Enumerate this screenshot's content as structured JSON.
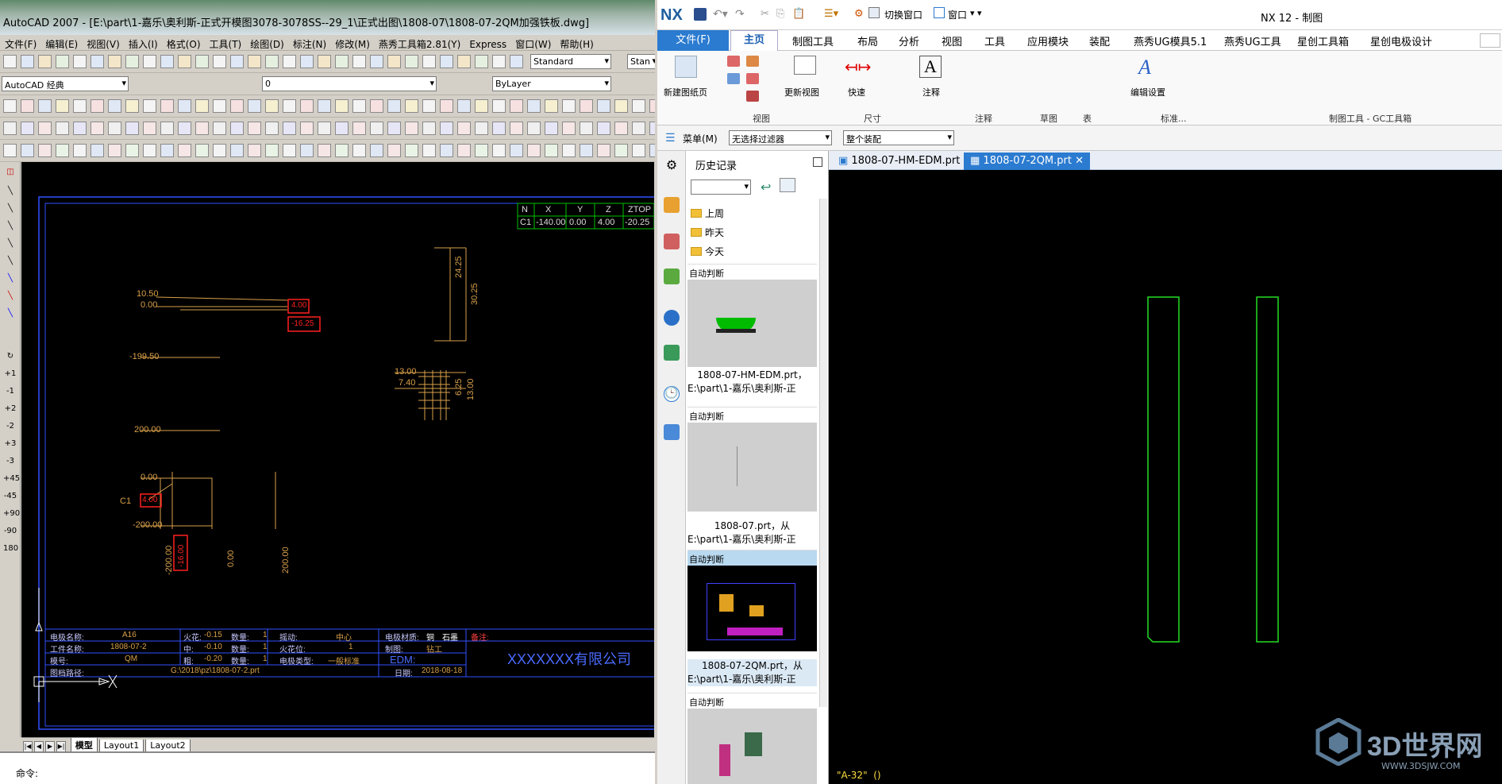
{
  "acad": {
    "title": "AutoCAD 2007 - [E:\\part\\1-嘉乐\\奥利斯-正式开模图3078-3078SS--29_1\\正式出图\\1808-07\\1808-07-2QM加强铁板.dwg]",
    "menu": [
      "文件(F)",
      "编辑(E)",
      "视图(V)",
      "插入(I)",
      "格式(O)",
      "工具(T)",
      "绘图(D)",
      "标注(N)",
      "修改(M)",
      "燕秀工具箱2.81(Y)",
      "Express",
      "窗口(W)",
      "帮助(H)"
    ],
    "workspace": "AutoCAD 经典",
    "layer": "0",
    "text_style": "Standard",
    "dim_style": "Stan",
    "linetype": "ByLayer",
    "side_tools": [
      "+1",
      "-1",
      "+2",
      "-2",
      "+3",
      "-3",
      "+45",
      "-45",
      "+90",
      "-90",
      "180"
    ],
    "coord_table": {
      "headers": [
        "N",
        "X",
        "Y",
        "Z",
        "ZTOP"
      ],
      "row": [
        "C1",
        "-140.00",
        "0.00",
        "4.00",
        "-20.25"
      ]
    },
    "dims": {
      "d1": "10.50",
      "d2": "0.00",
      "d3": "-199.50",
      "d4": "200.00",
      "d5": "0.00",
      "d6": "-200.00",
      "v1": "24.25",
      "v2": "30.25",
      "h1": "13.00",
      "h2": "7.40",
      "v3": "6.25",
      "v4": "13.00",
      "c1": "C1",
      "vb1": "-200.00",
      "vb2": "0.00",
      "vb3": "200.00",
      "red1": "4.00",
      "red2": "-16.25",
      "red3": "4.00",
      "red4": "-16.00"
    },
    "titleblock": {
      "r1": [
        "电极名称:",
        "A16",
        "火花:",
        "-0.15",
        "数量:",
        "1",
        "摇动:",
        "中心",
        "电极材质:",
        "铜",
        "石墨",
        "备注:"
      ],
      "r2": [
        "工件名称:",
        "1808-07-2",
        "中:",
        "-0.10",
        "数量:",
        "1",
        "火花位:",
        "1",
        "制图:",
        "钻工"
      ],
      "r3": [
        "模号:",
        "QM",
        "粗:",
        "-0.20",
        "数量:",
        "1",
        "电极类型:",
        "一般标准",
        "EDM:"
      ],
      "r4": [
        "图档路径:",
        "G:\\2018\\pz\\1808-07-2.prt",
        "日期:",
        "2018-08-18"
      ],
      "company": "XXXXXXX有限公司"
    },
    "layout_tabs": [
      "模型",
      "Layout1",
      "Layout2"
    ],
    "command_prompt": "命令:"
  },
  "nx": {
    "logo": "NX",
    "switch_window": "切换窗口",
    "window_menu": "窗口",
    "app_title": "NX 12 - 制图",
    "file_tab": "文件(F)",
    "tabs": [
      "主页",
      "制图工具",
      "布局",
      "分析",
      "视图",
      "工具",
      "应用模块",
      "装配",
      "燕秀UG模具5.1",
      "燕秀UG工具",
      "星创工具箱",
      "星创电极设计"
    ],
    "ribbon_buttons": {
      "new_sheet": "新建图纸页",
      "update_view": "更新视图",
      "quick": "快速",
      "note": "注释",
      "edit_settings": "编辑设置"
    },
    "ribbon_groups": [
      "视图",
      "尺寸",
      "注释",
      "草图",
      "表",
      "标准...",
      "制图工具 - GC工具箱"
    ],
    "menu_btn": "菜单(M)",
    "filter": "无选择过滤器",
    "assembly": "整个装配",
    "history": {
      "title": "历史记录",
      "folders": [
        "上周",
        "昨天",
        "今天"
      ],
      "auto": "自动判断",
      "items": [
        {
          "l1": "1808-07-HM-EDM.prt，",
          "l2": "E:\\part\\1-嘉乐\\奥利斯-正"
        },
        {
          "l1": "1808-07.prt，从",
          "l2": "E:\\part\\1-嘉乐\\奥利斯-正"
        },
        {
          "l1": "1808-07-2QM.prt，从",
          "l2": "E:\\part\\1-嘉乐\\奥利斯-正"
        }
      ]
    },
    "doc_tabs": [
      "1808-07-HM-EDM.prt",
      "1808-07-2QM.prt"
    ],
    "view_label": "\"A-32\"  ()",
    "watermark": "3D世界网",
    "watermark_url": "WWW.3DSJW.COM"
  }
}
